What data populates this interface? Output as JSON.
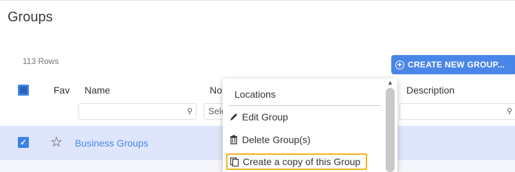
{
  "page": {
    "title": "Groups",
    "rows_count": "113 Rows"
  },
  "toolbar": {
    "create_label": "CREATE NEW GROUP..."
  },
  "columns": {
    "fav": "Fav",
    "name": "Name",
    "no": "No.",
    "description": "Description"
  },
  "filters": {
    "no_select_placeholder": "Sele"
  },
  "rows": [
    {
      "name": "Business Groups",
      "favorite": false,
      "checked": true
    }
  ],
  "context_menu": {
    "header": "Locations",
    "items": [
      {
        "label": "Edit Group",
        "icon": "pencil-icon"
      },
      {
        "label": "Delete Group(s)",
        "icon": "trash-icon"
      },
      {
        "label": "Create a copy of this Group",
        "icon": "copy-icon"
      }
    ]
  },
  "colors": {
    "accent": "#4a86e8",
    "selected_row": "#dfe6fb",
    "highlight_border": "#f2b21b"
  }
}
